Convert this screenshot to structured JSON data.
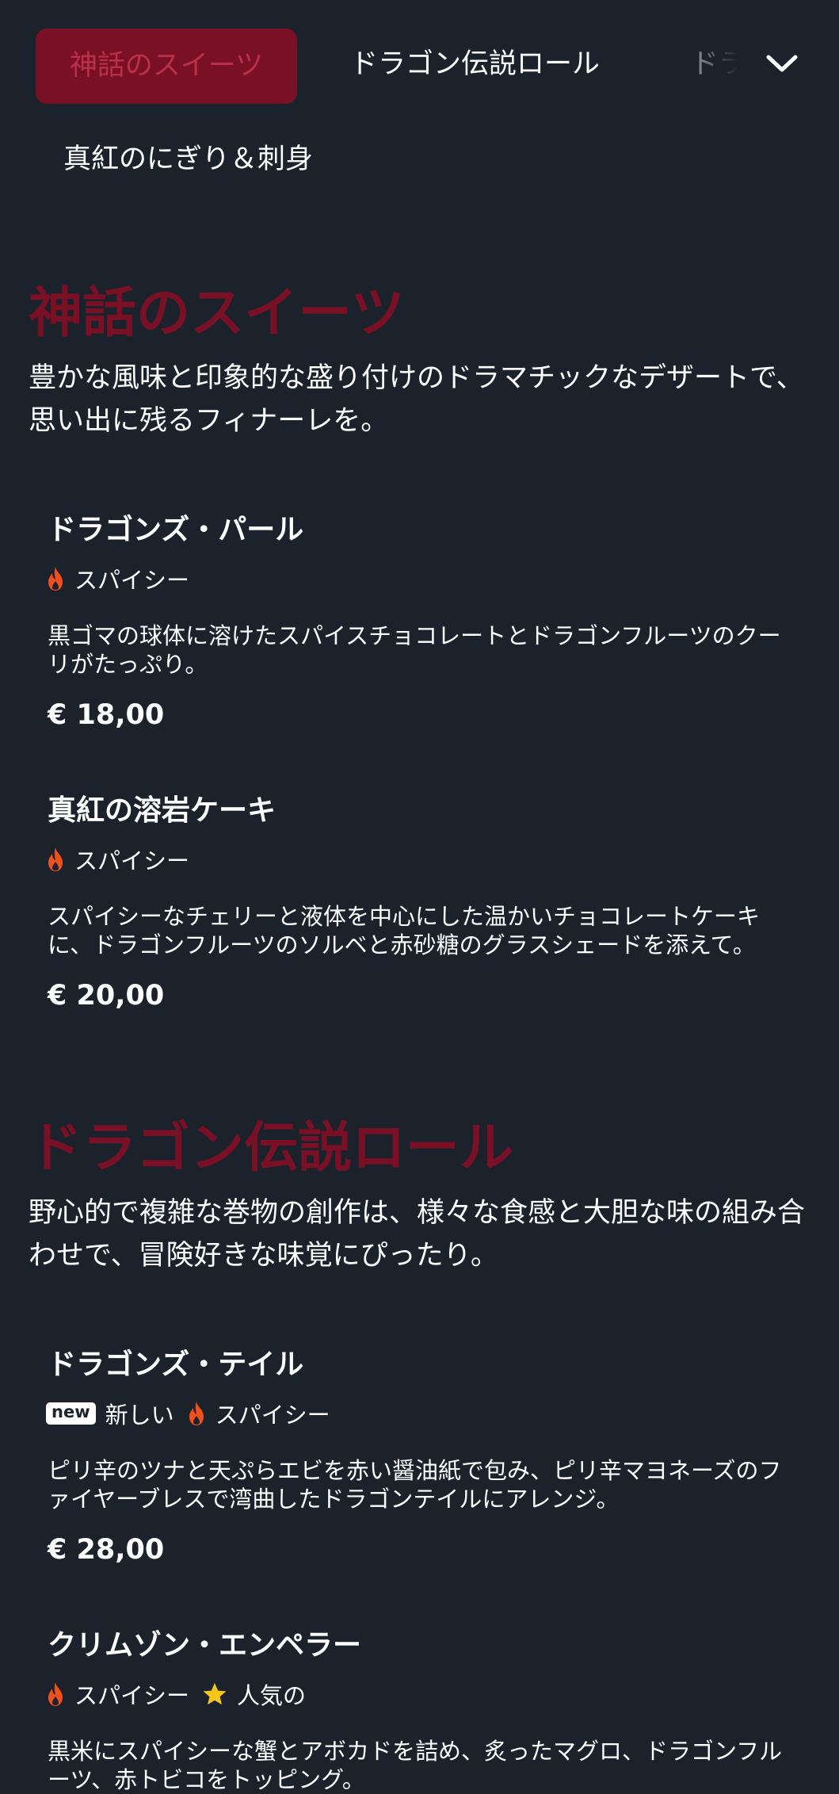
{
  "nav": {
    "tabs": [
      {
        "label": "神話のスイーツ"
      },
      {
        "label": "ドラゴン伝説ロール"
      },
      {
        "label": "ドラ"
      },
      {
        "label": "真紅のにぎり＆刺身"
      }
    ]
  },
  "sections": [
    {
      "title": "神話のスイーツ",
      "description": "豊かな風味と印象的な盛り付けのドラマチックなデザートで、思い出に残るフィナーレを。",
      "items": [
        {
          "name": "ドラゴンズ・パール",
          "tags": {
            "spicy": "スパイシー"
          },
          "description": "黒ゴマの球体に溶けたスパイスチョコレートとドラゴンフルーツのクーリがたっぷり。",
          "price": "€ 18,00"
        },
        {
          "name": "真紅の溶岩ケーキ",
          "tags": {
            "spicy": "スパイシー"
          },
          "description": "スパイシーなチェリーと液体を中心にした温かいチョコレートケーキに、ドラゴンフルーツのソルベと赤砂糖のグラスシェードを添えて。",
          "price": "€ 20,00"
        }
      ]
    },
    {
      "title": "ドラゴン伝説ロール",
      "description": "野心的で複雑な巻物の創作は、様々な食感と大胆な味の組み合わせで、冒険好きな味覚にぴったり。",
      "items": [
        {
          "name": "ドラゴンズ・テイル",
          "tags": {
            "new_badge": "new",
            "new": "新しい",
            "spicy": "スパイシー"
          },
          "description": "ピリ辛のツナと天ぷらエビを赤い醤油紙で包み、ピリ辛マヨネーズのファイヤーブレスで湾曲したドラゴンテイルにアレンジ。",
          "price": "€ 28,00"
        },
        {
          "name": "クリムゾン・エンペラー",
          "tags": {
            "spicy": "スパイシー",
            "popular": "人気の"
          },
          "description": "黒米にスパイシーな蟹とアボカドを詰め、炙ったマグロ、ドラゴンフルーツ、赤トビコをトッピング。"
        }
      ]
    }
  ],
  "icons": {
    "spicy": "flame-icon",
    "popular": "star-icon",
    "expand": "chevron-down-icon"
  },
  "colors": {
    "background": "#1c222b",
    "accent": "#7a1026",
    "flame": "#f0501e",
    "star": "#f5c518"
  }
}
